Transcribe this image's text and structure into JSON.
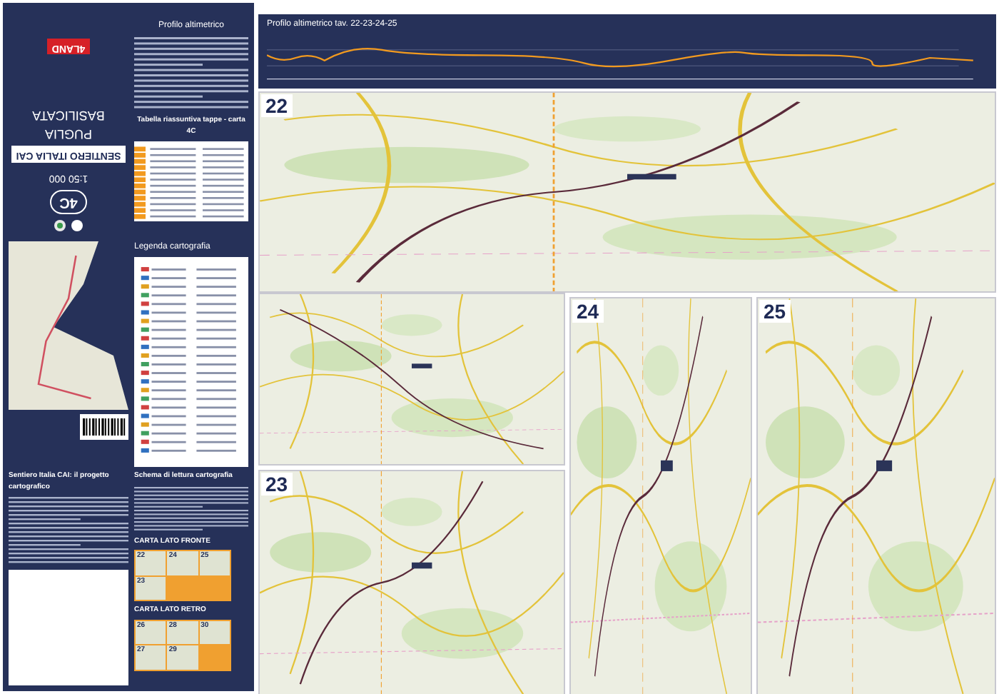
{
  "cover": {
    "publisher": "4LAND",
    "series": "SENTIERO ITALIA CAI",
    "regions": [
      "PUGLIA",
      "BASILICATA"
    ],
    "scale": "1:50 000",
    "sheet": "4C"
  },
  "profile_text": {
    "title": "Profilo altimetrico"
  },
  "stage_table": {
    "title": "Tabella riassuntiva tappe - carta 4C"
  },
  "legend": {
    "title": "Legenda cartografia"
  },
  "project": {
    "title": "Sentiero Italia CAI: il progetto cartografico"
  },
  "schema": {
    "title": "Schema di lettura cartografia",
    "sides": [
      {
        "label": "CARTA LATO FRONTE",
        "tiles": [
          "22",
          "24",
          "25",
          "23"
        ]
      },
      {
        "label": "CARTA LATO RETRO",
        "tiles": [
          "26",
          "28",
          "30",
          "27",
          "29"
        ]
      }
    ]
  },
  "elevation_profile": {
    "title": "Profilo altimetrico tav. 22-23-24-25"
  },
  "maps": [
    {
      "number": "22"
    },
    {
      "number": "23"
    },
    {
      "number": "24"
    },
    {
      "number": "25"
    }
  ]
}
